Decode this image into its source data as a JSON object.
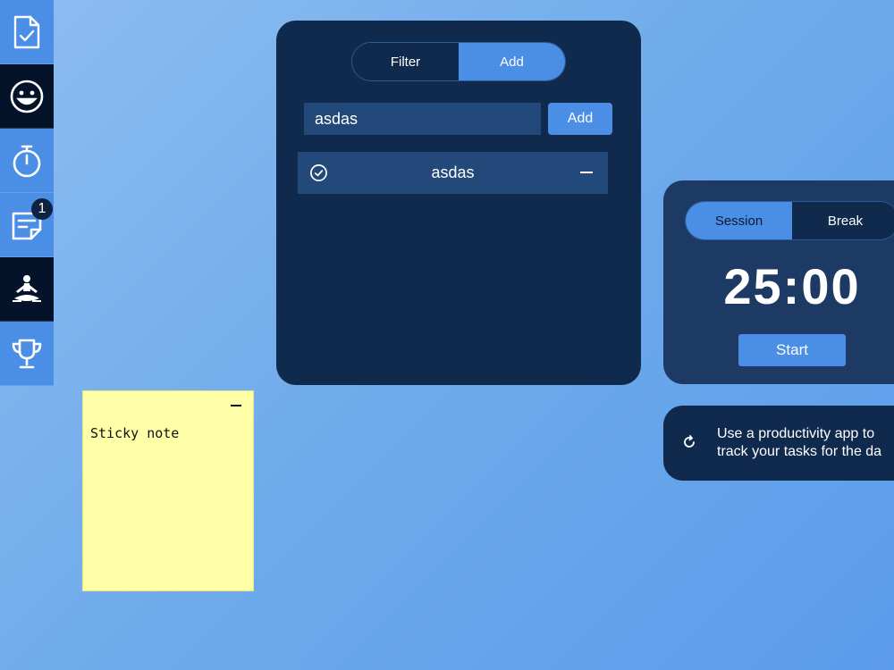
{
  "sidebar": {
    "items": [
      {
        "name": "tasks",
        "icon": "task-list-icon"
      },
      {
        "name": "mood",
        "icon": "smiley-icon"
      },
      {
        "name": "timer",
        "icon": "stopwatch-icon"
      },
      {
        "name": "notes",
        "icon": "sticky-note-icon",
        "badge": "1"
      },
      {
        "name": "meditate",
        "icon": "meditation-icon"
      },
      {
        "name": "achievements",
        "icon": "trophy-icon"
      }
    ]
  },
  "sticky_note": {
    "text": "Sticky note"
  },
  "todo": {
    "tabs": [
      {
        "label": "Filter",
        "active": false
      },
      {
        "label": "Add",
        "active": true
      }
    ],
    "input_value": "asdas",
    "add_label": "Add",
    "tasks": [
      {
        "text": "asdas"
      }
    ]
  },
  "timer": {
    "tabs": [
      {
        "label": "Session",
        "active": true
      },
      {
        "label": "Break",
        "active": false
      }
    ],
    "time": "25:00",
    "start_label": "Start"
  },
  "tip": {
    "line1": "Use a productivity app to",
    "line2": "track your tasks for the da"
  },
  "colors": {
    "accent": "#4a8ee6",
    "panel_dark": "#102a4d",
    "sticky": "#ffffa8"
  }
}
